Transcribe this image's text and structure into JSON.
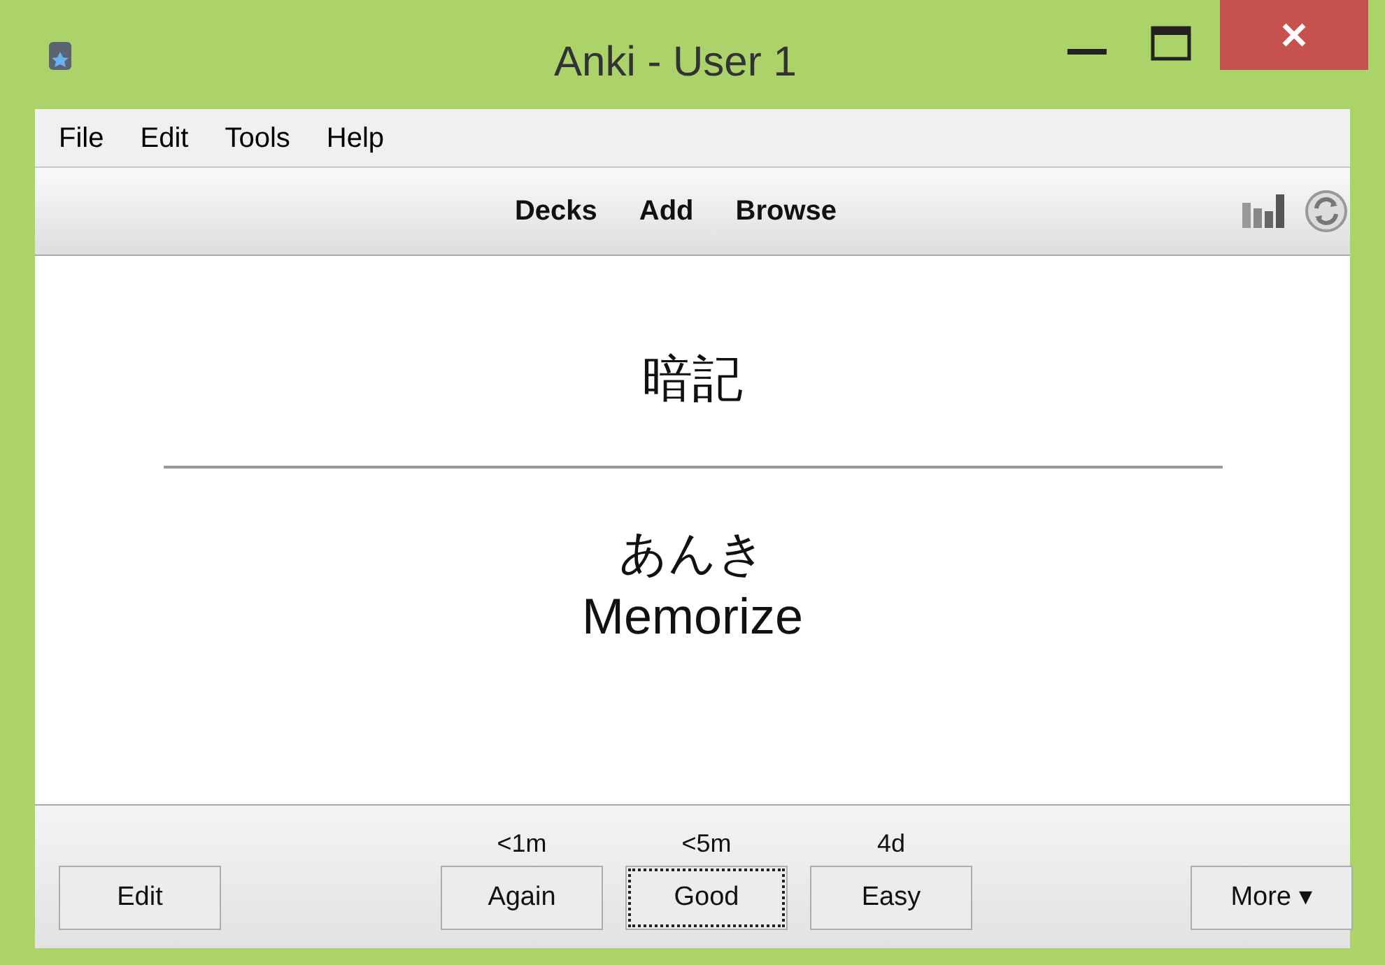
{
  "window": {
    "title": "Anki - User 1"
  },
  "menu": [
    "File",
    "Edit",
    "Tools",
    "Help"
  ],
  "toolbar": {
    "links": [
      "Decks",
      "Add",
      "Browse"
    ]
  },
  "card": {
    "front": "暗記",
    "reading": "あんき",
    "meaning": "Memorize"
  },
  "bottom_bar": {
    "edit_button": "Edit",
    "answers": [
      {
        "interval": "<1m",
        "label": "Again",
        "focused": false
      },
      {
        "interval": "<5m",
        "label": "Good",
        "focused": true
      },
      {
        "interval": "4d",
        "label": "Easy",
        "focused": false
      }
    ],
    "more_button": "More ▾"
  }
}
